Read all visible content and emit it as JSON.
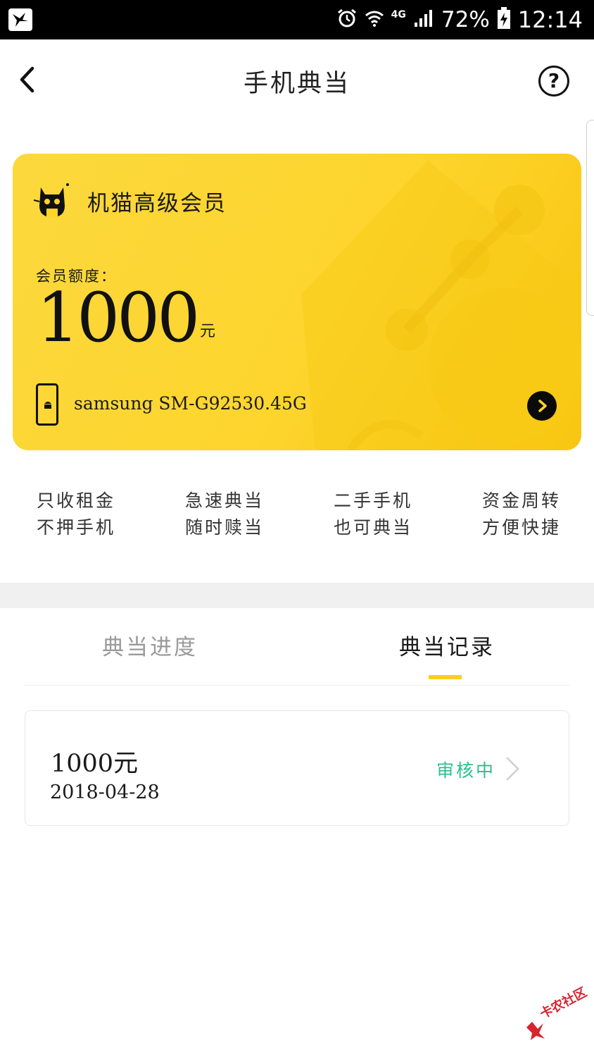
{
  "status_bar": {
    "network": "4G",
    "battery": "72%",
    "time": "12:14"
  },
  "header": {
    "title": "手机典当",
    "back_icon": "chevron-left-icon",
    "help_icon": "question-circle-icon",
    "help_symbol": "?"
  },
  "card": {
    "title": "机猫高级会员",
    "credit_label": "会员额度：",
    "credit_amount": "1000",
    "credit_unit": "元",
    "device_name": "samsung SM-G92530.45G",
    "colors": {
      "background": "#fdd52d",
      "arrow": "#0a0a0a"
    }
  },
  "features": [
    {
      "line1": "只收租金",
      "line2": "不押手机"
    },
    {
      "line1": "急速典当",
      "line2": "随时赎当"
    },
    {
      "line1": "二手手机",
      "line2": "也可典当"
    },
    {
      "line1": "资金周转",
      "line2": "方便快捷"
    }
  ],
  "tabs": {
    "progress": "典当进度",
    "records": "典当记录",
    "active": "records",
    "indicator_color": "#f7cf1f"
  },
  "records": [
    {
      "amount": "1000元",
      "date": "2018-04-28",
      "status": "审核中",
      "status_color": "#2bbf8f"
    }
  ],
  "watermark": {
    "text": "卡农社区"
  }
}
